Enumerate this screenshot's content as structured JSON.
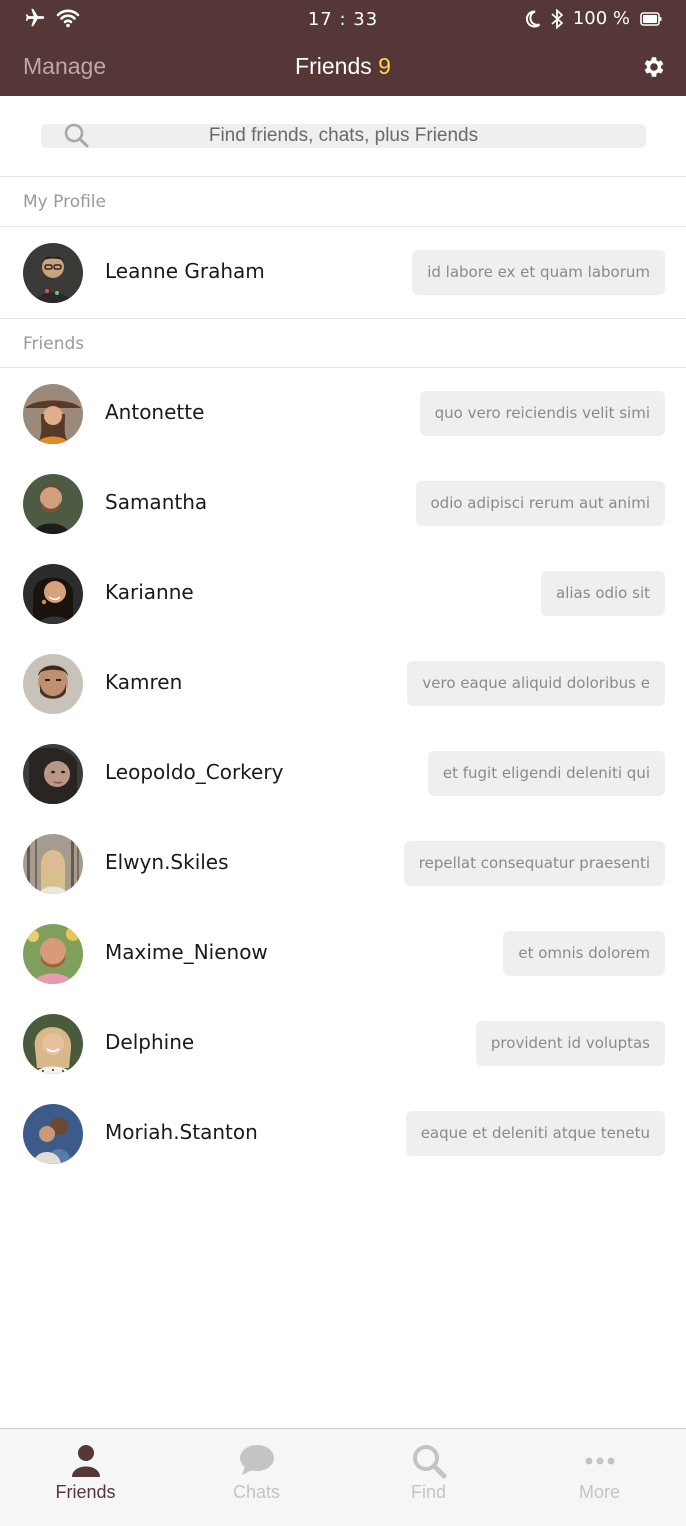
{
  "status_bar": {
    "time": "17 : 33",
    "battery": "100 %"
  },
  "header": {
    "manage_label": "Manage",
    "title": "Friends",
    "count": "9"
  },
  "search": {
    "placeholder": "Find friends, chats, plus Friends"
  },
  "sections": {
    "my_profile": "My Profile",
    "friends": "Friends"
  },
  "profile": {
    "name": "Leanne Graham",
    "status": "id labore ex et quam laborum"
  },
  "friends": [
    {
      "name": "Antonette",
      "status": "quo vero reiciendis velit simi"
    },
    {
      "name": "Samantha",
      "status": "odio adipisci rerum aut animi"
    },
    {
      "name": "Karianne",
      "status": "alias odio sit"
    },
    {
      "name": "Kamren",
      "status": "vero eaque aliquid doloribus e"
    },
    {
      "name": "Leopoldo_Corkery",
      "status": "et fugit eligendi deleniti qui"
    },
    {
      "name": "Elwyn.Skiles",
      "status": "repellat consequatur praesenti"
    },
    {
      "name": "Maxime_Nienow",
      "status": "et omnis dolorem"
    },
    {
      "name": "Delphine",
      "status": "provident id voluptas"
    },
    {
      "name": "Moriah.Stanton",
      "status": "eaque et deleniti atque tenetu"
    }
  ],
  "tabs": [
    {
      "label": "Friends",
      "icon": "person-icon",
      "active": true
    },
    {
      "label": "Chats",
      "icon": "chat-bubble-icon",
      "active": false
    },
    {
      "label": "Find",
      "icon": "search-icon",
      "active": false
    },
    {
      "label": "More",
      "icon": "more-dots-icon",
      "active": false
    }
  ],
  "colors": {
    "header_bg": "#553737",
    "count_accent": "#ffd84a",
    "active_tab": "#553737",
    "inactive_tab": "#c4c4c4"
  }
}
